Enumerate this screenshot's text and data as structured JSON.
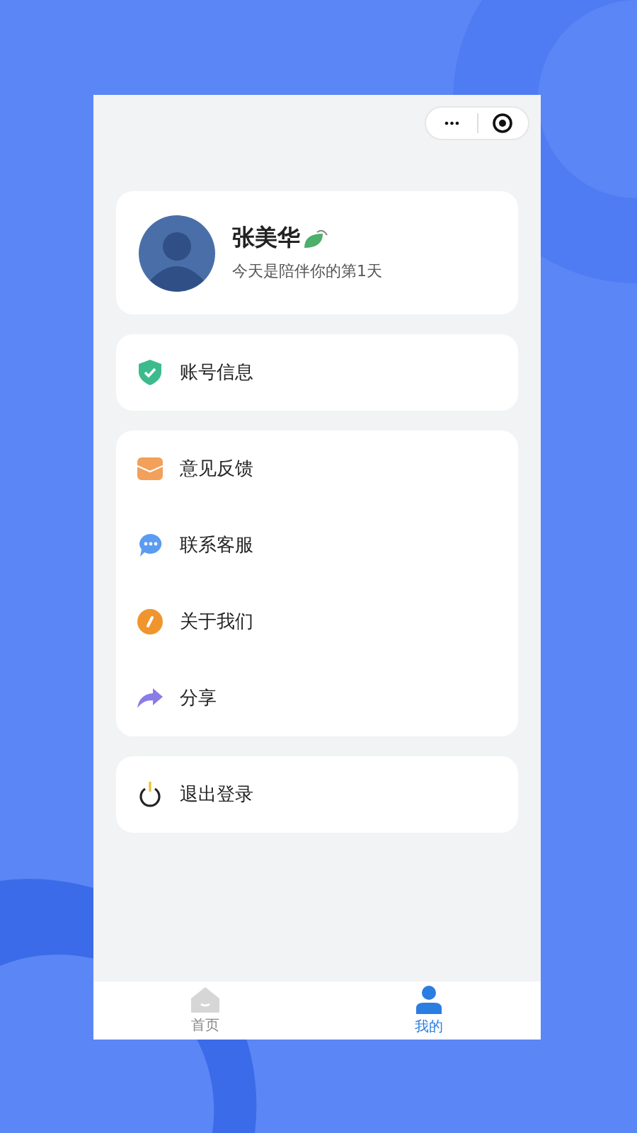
{
  "capsule": {
    "more_button": "•••"
  },
  "profile": {
    "name": "张美华",
    "subtitle": "今天是陪伴你的第1天"
  },
  "menu_groups": [
    {
      "items": [
        {
          "kind": "account",
          "label": "账号信息"
        }
      ]
    },
    {
      "items": [
        {
          "kind": "feedback",
          "label": "意见反馈"
        },
        {
          "kind": "service",
          "label": "联系客服"
        },
        {
          "kind": "about",
          "label": "关于我们"
        },
        {
          "kind": "share",
          "label": "分享"
        }
      ]
    },
    {
      "items": [
        {
          "kind": "logout",
          "label": "退出登录"
        }
      ]
    }
  ],
  "tab_bar": [
    {
      "kind": "home",
      "label": "首页",
      "selected": false
    },
    {
      "kind": "me",
      "label": "我的",
      "selected": true
    }
  ]
}
